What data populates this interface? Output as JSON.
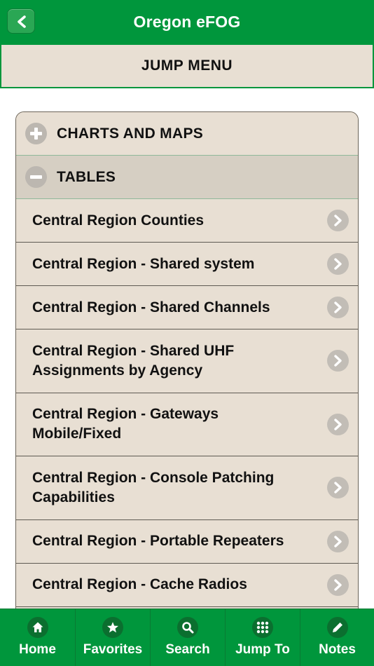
{
  "header": {
    "title": "Oregon eFOG",
    "back_icon": "chevron-left-icon"
  },
  "jump_menu": {
    "title": "JUMP MENU"
  },
  "accordion": {
    "sections": [
      {
        "label": "CHARTS AND MAPS",
        "state": "collapsed",
        "icon": "plus-icon"
      },
      {
        "label": "TABLES",
        "state": "expanded",
        "icon": "minus-icon"
      }
    ],
    "tables_items": [
      {
        "label": "Central Region Counties"
      },
      {
        "label": "Central Region - Shared system"
      },
      {
        "label": "Central Region - Shared Channels"
      },
      {
        "label": "Central Region - Shared UHF Assignments by Agency"
      },
      {
        "label": "Central Region - Gateways Mobile/Fixed"
      },
      {
        "label": "Central Region - Console Patching Capabilities"
      },
      {
        "label": "Central Region - Portable Repeaters"
      },
      {
        "label": "Central Region - Cache Radios"
      }
    ]
  },
  "bottom_nav": {
    "tabs": [
      {
        "label": "Home",
        "icon": "home-icon"
      },
      {
        "label": "Favorites",
        "icon": "star-icon"
      },
      {
        "label": "Search",
        "icon": "search-icon"
      },
      {
        "label": "Jump To",
        "icon": "grid-icon"
      },
      {
        "label": "Notes",
        "icon": "pencil-icon"
      }
    ]
  },
  "colors": {
    "brand_green": "#00963c",
    "panel_beige": "#e8dfd3",
    "expanded_header": "#d6cfc3",
    "icon_gray": "#bcb7b0"
  }
}
